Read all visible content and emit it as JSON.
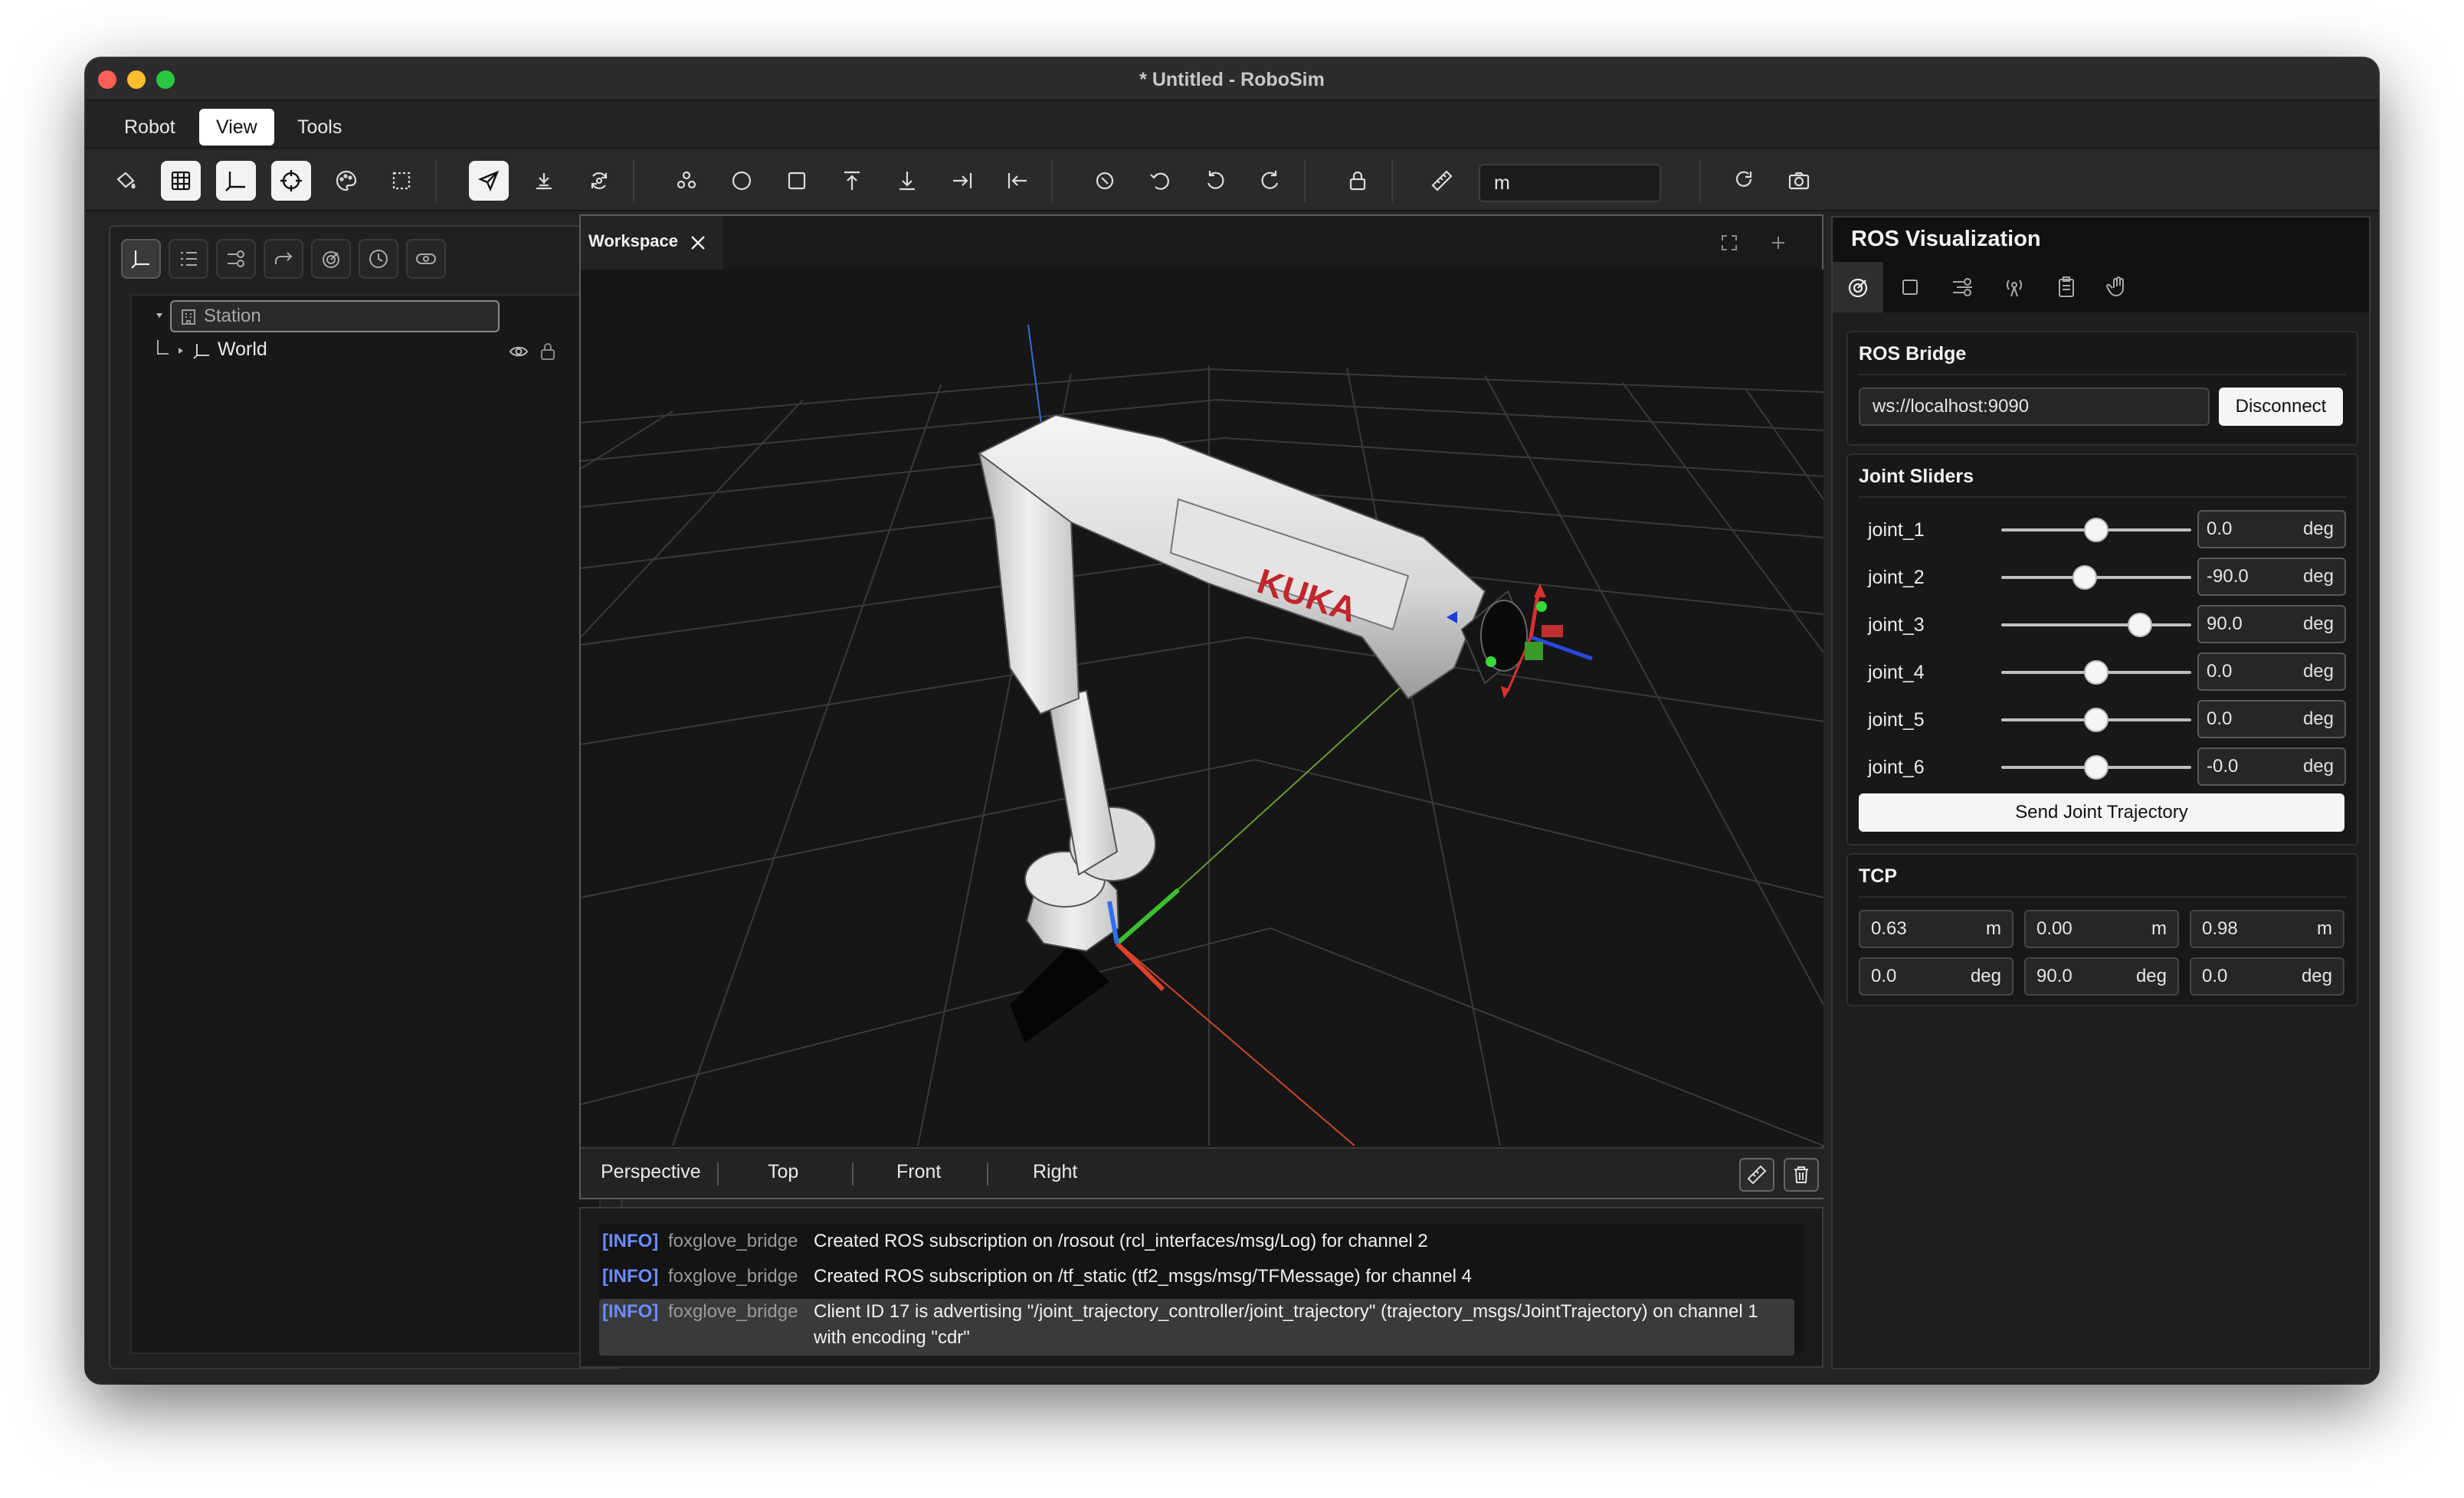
{
  "window": {
    "title": "* Untitled - RoboSim"
  },
  "menu": [
    {
      "label": "Robot"
    },
    {
      "label": "View"
    },
    {
      "label": "Tools"
    }
  ],
  "toolbar": {
    "unit_value": "m"
  },
  "left_panel": {
    "tree": [
      {
        "label": "Station"
      },
      {
        "label": "World"
      }
    ]
  },
  "workspace": {
    "tab_label": "Workspace",
    "robot_brand": "KUKA",
    "views": [
      {
        "label": "Perspective"
      },
      {
        "label": "Top"
      },
      {
        "label": "Front"
      },
      {
        "label": "Right"
      }
    ]
  },
  "log": {
    "entries": [
      {
        "level": "[INFO]",
        "source": "foxglove_bridge",
        "message": "Created ROS subscription on /rosout (rcl_interfaces/msg/Log) for channel 2"
      },
      {
        "level": "[INFO]",
        "source": "foxglove_bridge",
        "message": "Created ROS subscription on /tf_static (tf2_msgs/msg/TFMessage) for channel 4"
      },
      {
        "level": "[INFO]",
        "source": "foxglove_bridge",
        "message": "Client ID 17 is advertising \"/joint_trajectory_controller/joint_trajectory\" (trajectory_msgs/JointTrajectory) on channel 1 with encoding \"cdr\""
      }
    ]
  },
  "ros_panel": {
    "title": "ROS Visualization",
    "bridge": {
      "title": "ROS Bridge",
      "url": "ws://localhost:9090",
      "button": "Disconnect"
    },
    "joints": {
      "title": "Joint Sliders",
      "unit": "deg",
      "items": [
        {
          "name": "joint_1",
          "value": "0.0",
          "fraction": 0.5
        },
        {
          "name": "joint_2",
          "value": "-90.0",
          "fraction": 0.44
        },
        {
          "name": "joint_3",
          "value": "90.0",
          "fraction": 0.73
        },
        {
          "name": "joint_4",
          "value": "0.0",
          "fraction": 0.5
        },
        {
          "name": "joint_5",
          "value": "0.0",
          "fraction": 0.5
        },
        {
          "name": "joint_6",
          "value": "-0.0",
          "fraction": 0.5
        }
      ],
      "send_button": "Send Joint Trajectory"
    },
    "tcp": {
      "title": "TCP",
      "position": [
        {
          "value": "0.63",
          "unit": "m"
        },
        {
          "value": "0.00",
          "unit": "m"
        },
        {
          "value": "0.98",
          "unit": "m"
        }
      ],
      "rotation": [
        {
          "value": "0.0",
          "unit": "deg"
        },
        {
          "value": "90.0",
          "unit": "deg"
        },
        {
          "value": "0.0",
          "unit": "deg"
        }
      ]
    }
  }
}
